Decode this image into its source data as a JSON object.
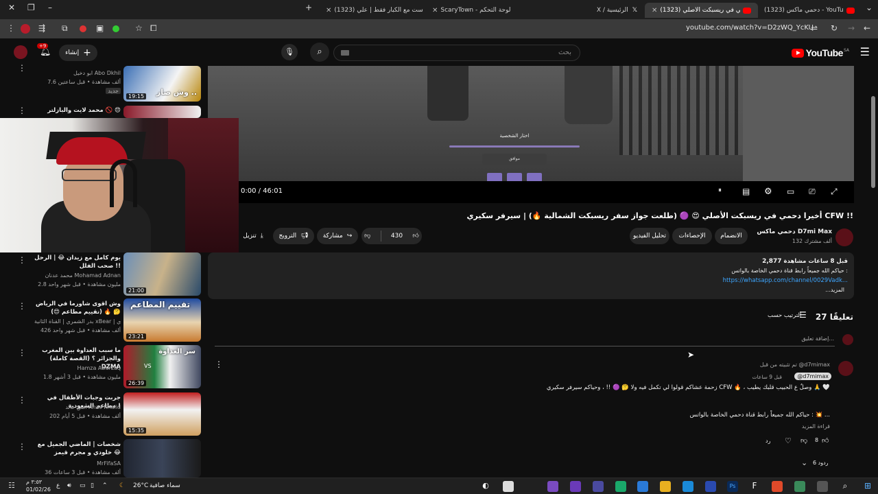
{
  "browser": {
    "tabs": [
      {
        "label": "(1323) دحمي ماكس - YouTube Max"
      },
      {
        "label": "(1323) أخيرا دحمي في ريسبكت الأصلي"
      },
      {
        "label": "X / الرئيسية"
      },
      {
        "label": "ScaryTown - لوحة التحكم"
      },
      {
        "label": "(1323) بودكاست مع الكبار فقط | علي"
      }
    ],
    "url": "youtube.com/watch?v=D2zWQ_YcKU"
  },
  "header": {
    "search_placeholder": "بحث",
    "logo_text": "YouTube",
    "logo_region": "SA",
    "create_label": "إنشاء",
    "notifications_badge": "+9"
  },
  "player": {
    "time": "0:00 / 46:01",
    "overlay_title": "اختار الشخصية",
    "overlay_button": "موافق"
  },
  "video": {
    "title": "أخيرا دحمي في ريسبكت الأصلي 😍 🟣 (طلعت جواز سفر ريسبكت الشمالية 🔥) | سيرفر سكيري CFW !!",
    "channel_name": "دحمي ماكس D7mi Max",
    "subscribers": "132 ألف مشترك",
    "join_label": "الانضمام",
    "stats_label": "الإحصاءات",
    "analytics_label": "تحليل الفيديو",
    "likes": "430",
    "share_label": "مشاركة",
    "promote_label": "الترويج",
    "download_label": "تنزيل"
  },
  "description": {
    "views": "2,877",
    "views_suffix": "مشاهدة",
    "time_ago": "قبل 8 ساعات",
    "line1": "حياكم الله جميعاً رابط قناة دحمي الخاصة بالواتس :",
    "link": "https://whatsapp.com/channel/0029Vadk...",
    "more": "...المزيد"
  },
  "comments": {
    "count_label": "27 تعليقًا",
    "sort_label": "الترتيب حسب",
    "add_placeholder": "إضافة تعليق...",
    "pinned_label": "تم تثبيته من قبل @d7mimax",
    "author": "@d7mimax",
    "time": "قبل 9 ساعات",
    "line1": "زحمة عشاكم قولوا لي تكمل فيه ولا 🤔 🟣 !! ، وحياكم سيرفر سكيري CFW 🔥 ، وصلٌ ع الحبيب قلبك يطيب 🙏 🤍",
    "line2": "حياكم الله جميعاً رابط قناة دحمي الخاصة بالواتس : 💥 ...",
    "read_more": "قراءة المزيد",
    "likes": "8",
    "reply_label": "رد",
    "replies_label": "6 ردود"
  },
  "sidebar": {
    "items": [
      {
        "title": "وش صار ..",
        "channel": "ابو دخيل Abo Dkhil",
        "meta": "7.6 ألف مشاهدة • قبل ساعتين",
        "badge": "جديد",
        "duration": "19:15"
      },
      {
        "title": "محمد لايت والبازلتر 🚫 😍",
        "channel": "",
        "meta": "",
        "badge": "",
        "duration": ""
      },
      {
        "title": "يوم كامل مع زيدان 😂 | الرحل صحب الفلل !!",
        "channel": "محمد عدنان Mohamad Adnan",
        "meta": "2.8 مليون مشاهدة • قبل شهر واحد",
        "badge": "",
        "duration": "21:00"
      },
      {
        "title": "وش اقوى شاورما في الرياض 🤔 🔥 (تقييم مطاعم 😍)",
        "channel": "بدر الشمري | القناة الثانية xBear | ابو عابد الشمري",
        "meta": "426 ألف مشاهدة • قبل شهر واحد",
        "badge": "",
        "duration": "23:21"
      },
      {
        "title": "ما سبب العداوة بين المغرب والجزائر ؟ (القصة كاملة) DZMA",
        "channel": "Hamza Abdrzaq",
        "meta": "1.8 مليون مشاهدة • قبل 3 أشهر",
        "badge": "",
        "duration": "26:39"
      },
      {
        "title": "جربت وجبات الأطفال في مطاعم السعودية !",
        "channel": "أنس خالد Anas Khalid",
        "meta": "202 ألف مشاهدة • قبل 5 أيام",
        "badge": "",
        "duration": "15:35"
      },
      {
        "title": "شخصات | الماضي الجميل مع خلودي و مجرم قيمز 😂",
        "channel": "MrFifaSA",
        "meta": "36 ألف مشاهدة • قبل 3 ساعات",
        "badge": "",
        "duration": ""
      }
    ],
    "thumb_texts": [
      "وش صار ..",
      "تقييم المطاعم",
      "سر العداوة",
      "VS"
    ]
  },
  "taskbar": {
    "weather": "سماء صافية",
    "temp": "26°C",
    "time": "٣:٥٣ م",
    "date": "01/02/26",
    "lang": "ع"
  }
}
